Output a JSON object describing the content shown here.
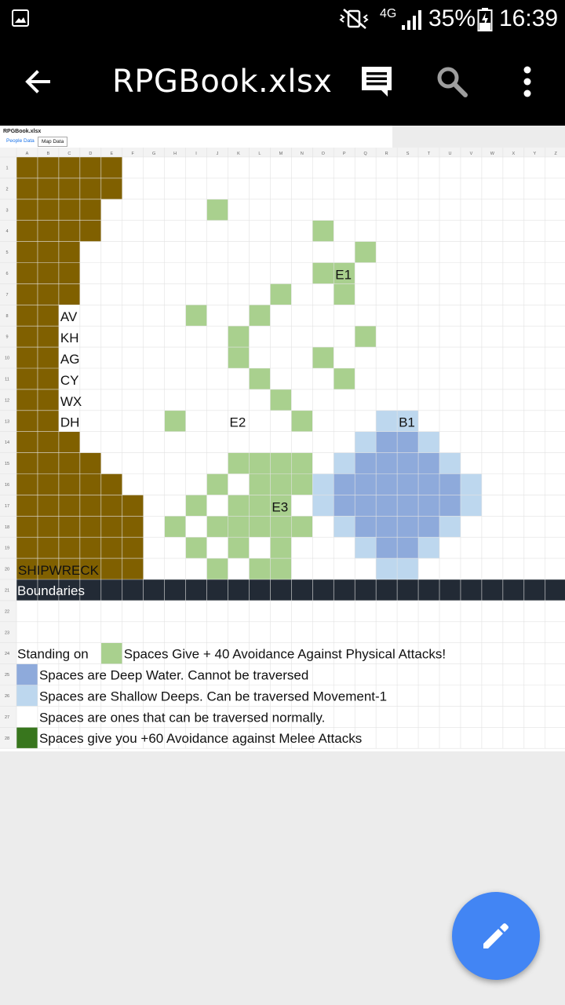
{
  "status_bar": {
    "network": "4G",
    "battery": "35%",
    "time": "16:39"
  },
  "app_bar": {
    "title": "RPGBook.xlsx",
    "icons": [
      "back-arrow-icon",
      "comment-icon",
      "search-icon",
      "more-vert-icon"
    ]
  },
  "sheet": {
    "file_name": "RPGBook.xlsx",
    "tabs": [
      {
        "label": "People Data",
        "active": false
      },
      {
        "label": "Map Data",
        "active": true
      }
    ],
    "column_headers": [
      "A",
      "B",
      "C",
      "D",
      "E",
      "F",
      "G",
      "H",
      "I",
      "J",
      "K",
      "L",
      "M",
      "N",
      "O",
      "P",
      "Q",
      "R",
      "S",
      "T",
      "U",
      "V",
      "W",
      "X",
      "Y",
      "Z"
    ],
    "row_headers": [
      "1",
      "2",
      "3",
      "4",
      "5",
      "6",
      "7",
      "8",
      "9",
      "10",
      "11",
      "12",
      "13",
      "14",
      "15",
      "16",
      "17",
      "18",
      "19",
      "20",
      "21",
      "22",
      "23",
      "24",
      "25",
      "26",
      "27",
      "28"
    ],
    "colors": {
      "brown": "#806000",
      "light_green": "#a9d08e",
      "deep_water": "#8eaadb",
      "shallow": "#bdd7ee",
      "dark_green": "#38761d",
      "band": "#222a35",
      "band_text": "#ffffff"
    },
    "map_rows": [
      {
        "row": 1,
        "brown_cols": 5,
        "green": [],
        "deep": [],
        "shallow": []
      },
      {
        "row": 2,
        "brown_cols": 5,
        "green": [],
        "deep": [],
        "shallow": []
      },
      {
        "row": 3,
        "brown_cols": 4,
        "green": [
          "J"
        ],
        "deep": [],
        "shallow": []
      },
      {
        "row": 4,
        "brown_cols": 4,
        "green": [
          "O"
        ],
        "deep": [],
        "shallow": []
      },
      {
        "row": 5,
        "brown_cols": 3,
        "green": [
          "Q"
        ],
        "deep": [],
        "shallow": []
      },
      {
        "row": 6,
        "brown_cols": 3,
        "green": [
          "O",
          "P"
        ],
        "deep": [],
        "shallow": []
      },
      {
        "row": 7,
        "brown_cols": 3,
        "green": [
          "M",
          "P"
        ],
        "deep": [],
        "shallow": []
      },
      {
        "row": 8,
        "brown_cols": 2,
        "green": [
          "I",
          "L"
        ],
        "deep": [],
        "shallow": []
      },
      {
        "row": 9,
        "brown_cols": 2,
        "green": [
          "K",
          "Q"
        ],
        "deep": [],
        "shallow": []
      },
      {
        "row": 10,
        "brown_cols": 2,
        "green": [
          "K",
          "O"
        ],
        "deep": [],
        "shallow": []
      },
      {
        "row": 11,
        "brown_cols": 2,
        "green": [
          "L",
          "P"
        ],
        "deep": [],
        "shallow": []
      },
      {
        "row": 12,
        "brown_cols": 2,
        "green": [
          "M"
        ],
        "deep": [],
        "shallow": []
      },
      {
        "row": 13,
        "brown_cols": 2,
        "green": [
          "H",
          "N"
        ],
        "deep": [],
        "shallow": [
          "R",
          "S"
        ]
      },
      {
        "row": 14,
        "brown_cols": 3,
        "green": [],
        "deep": [
          "R",
          "S"
        ],
        "shallow": [
          "Q",
          "T"
        ]
      },
      {
        "row": 15,
        "brown_cols": 4,
        "green": [
          "K",
          "L",
          "M",
          "N"
        ],
        "deep": [
          "Q",
          "R",
          "S",
          "T"
        ],
        "shallow": [
          "P",
          "U"
        ]
      },
      {
        "row": 16,
        "brown_cols": 5,
        "green": [
          "J",
          "L",
          "M",
          "N"
        ],
        "deep": [
          "P",
          "Q",
          "R",
          "S",
          "T",
          "U"
        ],
        "shallow": [
          "O",
          "V"
        ]
      },
      {
        "row": 17,
        "brown_cols": 6,
        "green": [
          "I",
          "K",
          "L",
          "M"
        ],
        "deep": [
          "P",
          "Q",
          "R",
          "S",
          "T",
          "U"
        ],
        "shallow": [
          "O",
          "V"
        ]
      },
      {
        "row": 18,
        "brown_cols": 6,
        "green": [
          "H",
          "J",
          "K",
          "L",
          "M",
          "N"
        ],
        "deep": [
          "Q",
          "R",
          "S",
          "T"
        ],
        "shallow": [
          "P",
          "U"
        ]
      },
      {
        "row": 19,
        "brown_cols": 6,
        "green": [
          "I",
          "K",
          "M"
        ],
        "deep": [
          "R",
          "S"
        ],
        "shallow": [
          "Q",
          "T"
        ]
      },
      {
        "row": 20,
        "brown_cols": 6,
        "green": [
          "J",
          "L",
          "M"
        ],
        "deep": [],
        "shallow": [
          "R",
          "S"
        ]
      }
    ],
    "cell_labels": [
      {
        "row": 6,
        "col": "P",
        "text": "E1"
      },
      {
        "row": 8,
        "col": "C",
        "text": "AV"
      },
      {
        "row": 9,
        "col": "C",
        "text": "KH"
      },
      {
        "row": 10,
        "col": "C",
        "text": "AG"
      },
      {
        "row": 11,
        "col": "C",
        "text": "CY"
      },
      {
        "row": 12,
        "col": "C",
        "text": "WX"
      },
      {
        "row": 13,
        "col": "C",
        "text": "DH"
      },
      {
        "row": 13,
        "col": "K",
        "text": "E2"
      },
      {
        "row": 13,
        "col": "S",
        "text": "B1"
      },
      {
        "row": 17,
        "col": "M",
        "text": "E3"
      },
      {
        "row": 20,
        "col": "A",
        "text": "SHIPWRECK"
      }
    ],
    "boundaries_band": {
      "row": 21,
      "label": "Boundaries"
    },
    "legend": [
      {
        "row": 24,
        "prefix": "Standing on",
        "swatch": "light_green",
        "text": "Spaces Give + 40 Avoidance Against Physical Attacks!"
      },
      {
        "row": 25,
        "swatch": "deep_water",
        "text": "Spaces are Deep Water. Cannot be traversed"
      },
      {
        "row": 26,
        "swatch": "shallow",
        "text": "Spaces are Shallow Deeps. Can be traversed Movement-1"
      },
      {
        "row": 27,
        "swatch": "white",
        "text": "Spaces are ones that can be traversed normally."
      },
      {
        "row": 28,
        "swatch": "dark_green",
        "text": "Spaces give you +60 Avoidance against Melee Attacks"
      }
    ]
  },
  "fab": {
    "icon": "edit-pencil-icon",
    "color": "#4285f4"
  }
}
